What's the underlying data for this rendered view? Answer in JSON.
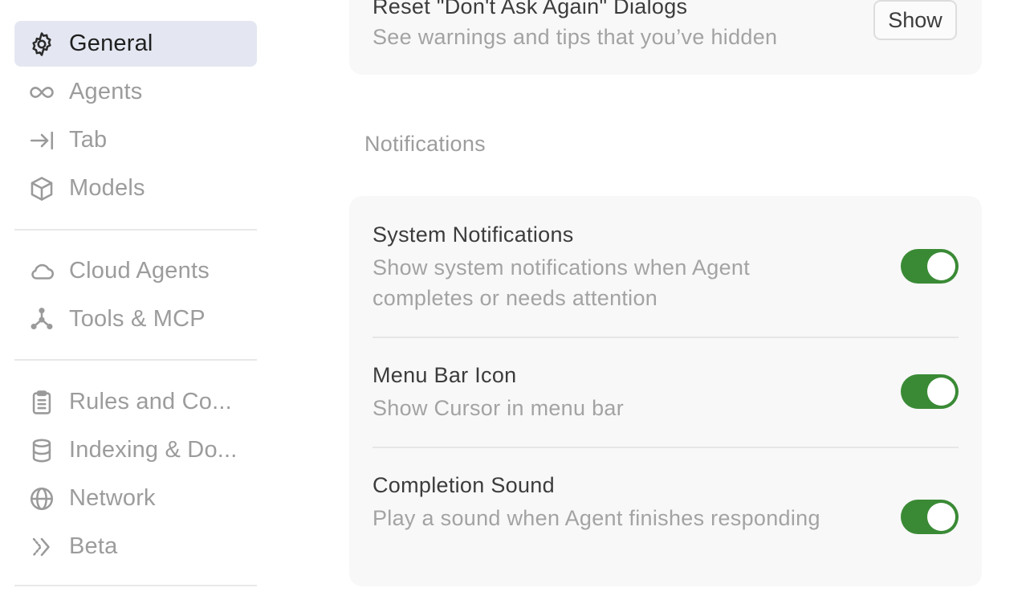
{
  "sidebar": {
    "items": [
      {
        "label": "General",
        "icon": "gear-icon",
        "active": true
      },
      {
        "label": "Agents",
        "icon": "infinity-icon"
      },
      {
        "label": "Tab",
        "icon": "arrow-to-line-icon"
      },
      {
        "label": "Models",
        "icon": "cube-icon"
      },
      {
        "label": "Cloud Agents",
        "icon": "cloud-icon"
      },
      {
        "label": "Tools & MCP",
        "icon": "nodes-icon"
      },
      {
        "label": "Rules and Co...",
        "icon": "clipboard-icon"
      },
      {
        "label": "Indexing & Do...",
        "icon": "database-icon"
      },
      {
        "label": "Network",
        "icon": "globe-icon"
      },
      {
        "label": "Beta",
        "icon": "double-chevron-icon"
      }
    ]
  },
  "main": {
    "reset_card": {
      "title": "Reset \"Don't Ask Again\" Dialogs",
      "description": "See warnings and tips that you’ve hidden",
      "button_label": "Show"
    },
    "notifications": {
      "heading": "Notifications",
      "rows": [
        {
          "title": "System Notifications",
          "description": "Show system notifications when Agent completes or needs attention",
          "enabled": true
        },
        {
          "title": "Menu Bar Icon",
          "description": "Show Cursor in menu bar",
          "enabled": true
        },
        {
          "title": "Completion Sound",
          "description": "Play a sound when Agent finishes responding",
          "enabled": true
        }
      ]
    }
  },
  "colors": {
    "accent_toggle": "#3a8a35",
    "active_nav_bg": "#e4e7f1",
    "card_bg": "#f8f8f8"
  }
}
